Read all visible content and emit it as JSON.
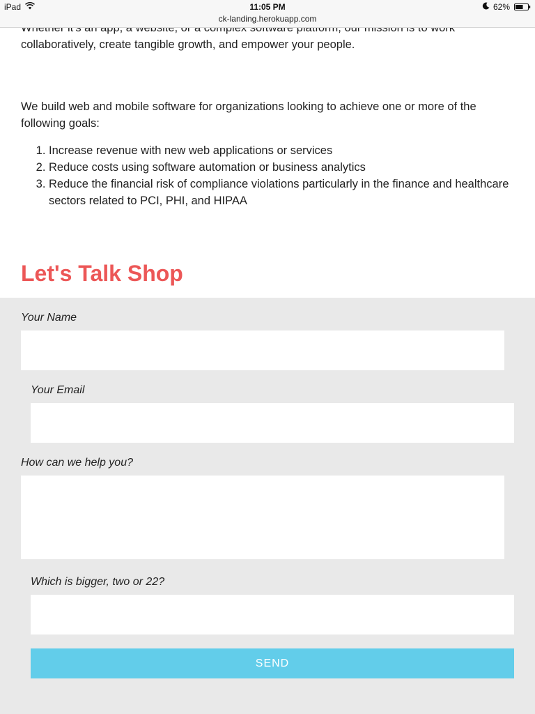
{
  "status_bar": {
    "device": "iPad",
    "time": "11:05 PM",
    "url": "ck-landing.herokuapp.com",
    "battery_percent": "62%",
    "icons": [
      "wifi-icon",
      "moon-icon",
      "battery-icon"
    ],
    "battery_level": 0.62
  },
  "intro": {
    "paragraph_1": "Whether it's an app, a website, or a complex software platform, our mission is to work collaboratively, create tangible growth, and empower your people.",
    "paragraph_2": "We build web and mobile software for organizations looking to achieve one or more of the following goals:",
    "goals": [
      "Increase revenue with new web applications or services",
      "Reduce costs using software automation or business analytics",
      "Reduce the financial risk of compliance violations particularly in the finance and healthcare sectors related to PCI, PHI, and HIPAA"
    ]
  },
  "contact": {
    "title": "Let's Talk Shop",
    "name_label": "Your Name",
    "name_value": "",
    "email_label": "Your Email",
    "email_value": "",
    "message_label": "How can we help you?",
    "message_value": "",
    "captcha_label": "Which is bigger, two or 22?",
    "captcha_value": "",
    "send_label": "SEND"
  },
  "colors": {
    "title": "#ec5757",
    "form_background": "#e9e9e9",
    "send_button": "#62cdea",
    "status_bar": "#f7f7f7"
  }
}
